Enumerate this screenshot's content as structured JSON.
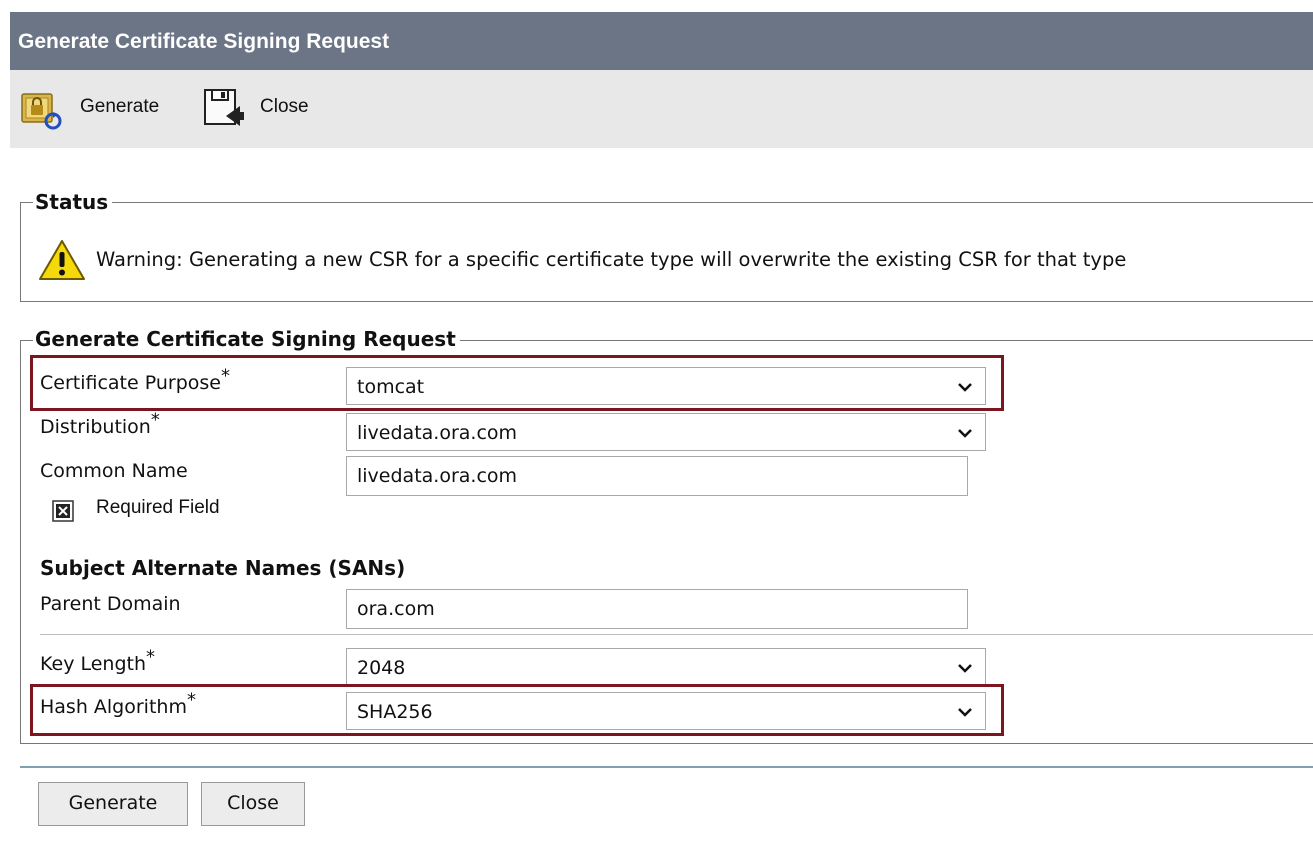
{
  "window": {
    "title": "Generate Certificate Signing Request"
  },
  "toolbar": {
    "generate": {
      "icon": "lock-refresh-icon",
      "label": "Generate"
    },
    "close": {
      "icon": "floppy-exit-icon",
      "label": "Close"
    }
  },
  "status": {
    "legend": "Status",
    "icon": "warning-icon",
    "message": "Warning: Generating a new CSR for a specific certificate type will overwrite the existing CSR for that type"
  },
  "form": {
    "legend": "Generate Certificate Signing Request",
    "certificate_purpose": {
      "label": "Certificate Purpose",
      "required_mark": "*",
      "value": "tomcat"
    },
    "distribution": {
      "label": "Distribution",
      "required_mark": "*",
      "value": "livedata.ora.com"
    },
    "common_name": {
      "label": "Common Name",
      "value": "livedata.ora.com"
    },
    "required_field_note": {
      "icon": "required-x-icon",
      "label": "Required Field"
    },
    "sans_heading": "Subject Alternate Names (SANs)",
    "parent_domain": {
      "label": "Parent Domain",
      "value": "ora.com"
    },
    "key_length": {
      "label": "Key Length",
      "required_mark": "*",
      "value": "2048"
    },
    "hash_algorithm": {
      "label": "Hash Algorithm",
      "required_mark": "*",
      "value": "SHA256"
    }
  },
  "buttons": {
    "generate": "Generate",
    "close": "Close"
  },
  "colors": {
    "titlebar": "#6b7585",
    "toolbar": "#e8e8e8",
    "highlight_border": "#7b1520",
    "warning_yellow": "#f5d90a"
  }
}
